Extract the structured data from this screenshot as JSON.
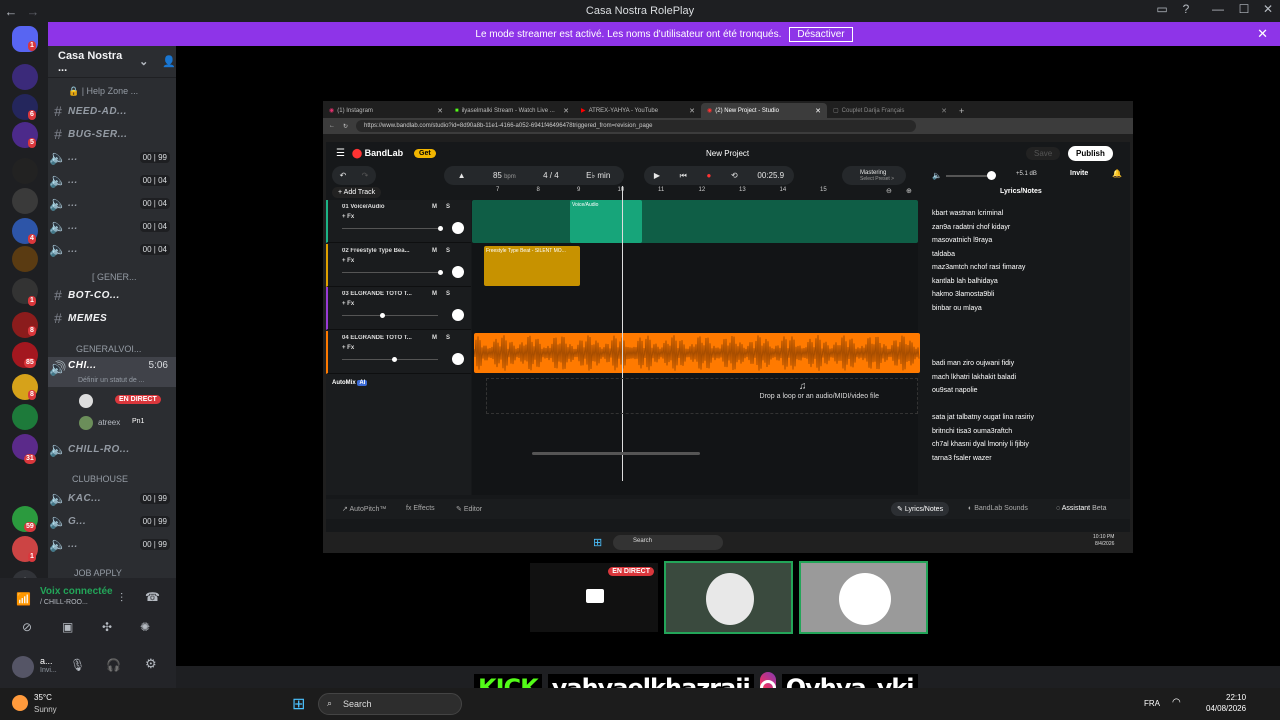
{
  "discord": {
    "title": "Casa Nostra RolePlay",
    "streamer_notice": "Le mode streamer est activé. Les noms d'utilisateur ont été tronqués.",
    "streamer_button": "Désactiver",
    "server_name": "Casa Nostra ...",
    "rail_badges": [
      "1",
      "6",
      "5",
      "4",
      "1",
      "8",
      "85",
      "8",
      "31",
      "59",
      "1"
    ],
    "channels": [
      {
        "type": "text",
        "name": "| Help Zone ...",
        "prefix": "🔒"
      },
      {
        "type": "text",
        "name": "NEED-AD...",
        "prefix": "# 🆘"
      },
      {
        "type": "text",
        "name": "BUG-SER...",
        "prefix": "# 🆘"
      },
      {
        "type": "voice",
        "name": "...",
        "count_a": "00",
        "count_b": "99"
      },
      {
        "type": "voice",
        "name": "...",
        "count_a": "00",
        "count_b": "04"
      },
      {
        "type": "voice",
        "name": "...",
        "count_a": "00",
        "count_b": "04"
      },
      {
        "type": "voice",
        "name": "...",
        "count_a": "00",
        "count_b": "04"
      },
      {
        "type": "voice",
        "name": "...",
        "count_a": "00",
        "count_b": "04"
      }
    ],
    "category_general": "[ GENER...",
    "bot_channel": "BOT-CO...",
    "memes_channel": "MEMES",
    "category_voice": "GENERALVOI...",
    "active_voice": {
      "name": "CHI...",
      "timer": "5:06",
      "status": "Définir un statut de ..."
    },
    "live_badge": "EN DIRECT",
    "member_2": "atreex",
    "member_2_tag": "Pn1",
    "chill_channel": "CHILL-RO...",
    "category_club": "CLUBHOUSE",
    "club_channels": [
      {
        "name": "KAC...",
        "count_a": "00",
        "count_b": "99"
      },
      {
        "name": "G...",
        "count_a": "00",
        "count_b": "99"
      },
      {
        "name": "...",
        "count_a": "00",
        "count_b": "99"
      }
    ],
    "category_job": "JOB APPLY",
    "voice_connected": "Voix connectée",
    "voice_channel": "/ CHILL-ROO...",
    "user_name": "a...",
    "user_status": "Invi..."
  },
  "browser": {
    "tabs": [
      "(1) Instagram",
      "ilyaselmalki Stream - Watch Live ...",
      "ATREX-YAHYA - YouTube",
      "(2) New Project - Studio",
      "Couplet Darija Français"
    ],
    "url": "https://www.bandlab.com/studio?id=8d90a8b-11e1-4166-a052-6941f46496478triggered_from=revision_page"
  },
  "bandlab": {
    "logo": "BandLab",
    "get_label": "Get",
    "project_title": "New Project",
    "save_label": "Save",
    "publish_label": "Publish",
    "bpm": "85",
    "bpm_unit": "bpm",
    "time_sig": "4 / 4",
    "key": "E♭ min",
    "time": "00:25.9",
    "mastering": "Mastering",
    "mastering_sub": "Select Preset >",
    "volume_db": "+5.1 dB",
    "invite_label": "Invite",
    "add_track": "Add Track",
    "ruler": [
      "7",
      "8",
      "9",
      "10",
      "11",
      "12",
      "13",
      "14",
      "15"
    ],
    "tracks": [
      {
        "name": "01  Voice/Audio",
        "fx": "+ Fx",
        "color": "#1db486"
      },
      {
        "name": "02  Freestyle Type Bea...",
        "fx": "+ Fx",
        "color": "#e0a100"
      },
      {
        "name": "03  ELGRANDE TOTO T...",
        "fx": "+ Fx",
        "color": "#9a3bd6"
      },
      {
        "name": "04  ELGRANDE TOTO T...",
        "fx": "+ Fx",
        "color": "#ff7a00"
      }
    ],
    "mute": "M",
    "solo": "S",
    "clip_voice": "Voice/Audio",
    "clip_beat": "Freestyle Type Beat - SILENT MO...",
    "automix": "AutoMix",
    "ai_tag": "AI",
    "drop_text": "Drop a loop or an audio/MIDI/video file",
    "lyrics_title": "Lyrics/Notes",
    "lyrics_block1": [
      "kbart wastnan lcriminal",
      "zan9a radatni chof kidayr",
      "masovatnich l9raya",
      "taldaba",
      "maz3amtch nchof rasi fimaray",
      "kantlab lah balhidaya",
      "hakmo 3lamosta9bli",
      "binbar ou mlaya"
    ],
    "lyrics_block2": [
      "badi man ziro oujwani fidiy",
      "mach lkhatri lakhakit baladi",
      "ou9sat napolie"
    ],
    "lyrics_block3": [
      "sata jat talbatny ougat lina rasiriy",
      "britnchi tisa3 ouma3raftch",
      "ch7al khasni dyal lmoniy li fjibiy",
      "tarna3 fsaler wazer"
    ],
    "footer": {
      "autopitch": "AutoPitch™",
      "effects": "Effects",
      "editor": "Editor",
      "lyrics": "Lyrics/Notes",
      "sounds": "BandLab Sounds",
      "assistant": "Assistant",
      "beta": "Beta"
    }
  },
  "capture_taskbar": {
    "search": "Search",
    "time": "10:10 PM",
    "date": "8/4/2026"
  },
  "webcam_live": "EN DIRECT",
  "overlay": {
    "kick": "KICK",
    "kick_name": "yahyaelkhazraji",
    "ig_name": "Oyhya_ykj"
  },
  "host_taskbar": {
    "temp": "35°C",
    "weather": "Sunny",
    "search": "Search",
    "lang": "FRA",
    "time": "22:10",
    "date": "04/08/2026"
  }
}
